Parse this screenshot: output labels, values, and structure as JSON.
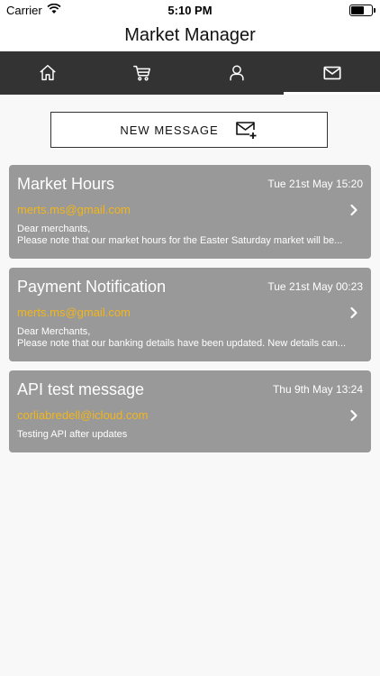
{
  "status_bar": {
    "carrier": "Carrier",
    "time": "5:10 PM"
  },
  "header": {
    "title": "Market Manager"
  },
  "tabs": [
    {
      "icon": "home-icon",
      "active": false
    },
    {
      "icon": "cart-icon",
      "active": false
    },
    {
      "icon": "user-icon",
      "active": false
    },
    {
      "icon": "mail-icon",
      "active": true
    }
  ],
  "new_message_button": {
    "label": "NEW MESSAGE",
    "icon": "mail-plus-icon"
  },
  "messages": [
    {
      "subject": "Market Hours",
      "date": "Tue 21st May 15:20",
      "sender": "merts.ms@gmail.com",
      "body_line1": "Dear merchants,",
      "body_line2": "Please note that our market hours for the Easter Saturday market will be..."
    },
    {
      "subject": "Payment Notification",
      "date": "Tue 21st May 00:23",
      "sender": "merts.ms@gmail.com",
      "body_line1": "Dear Merchants,",
      "body_line2": "Please note that our banking details have been updated. New details can..."
    },
    {
      "subject": "API test message",
      "date": "Thu 9th May 13:24",
      "sender": "corliabredell@icloud.com",
      "body_line1": "Testing API after updates",
      "body_line2": ""
    }
  ],
  "colors": {
    "tabbar_bg": "#333333",
    "card_bg": "#999999",
    "sender_accent": "#f3b61a"
  }
}
